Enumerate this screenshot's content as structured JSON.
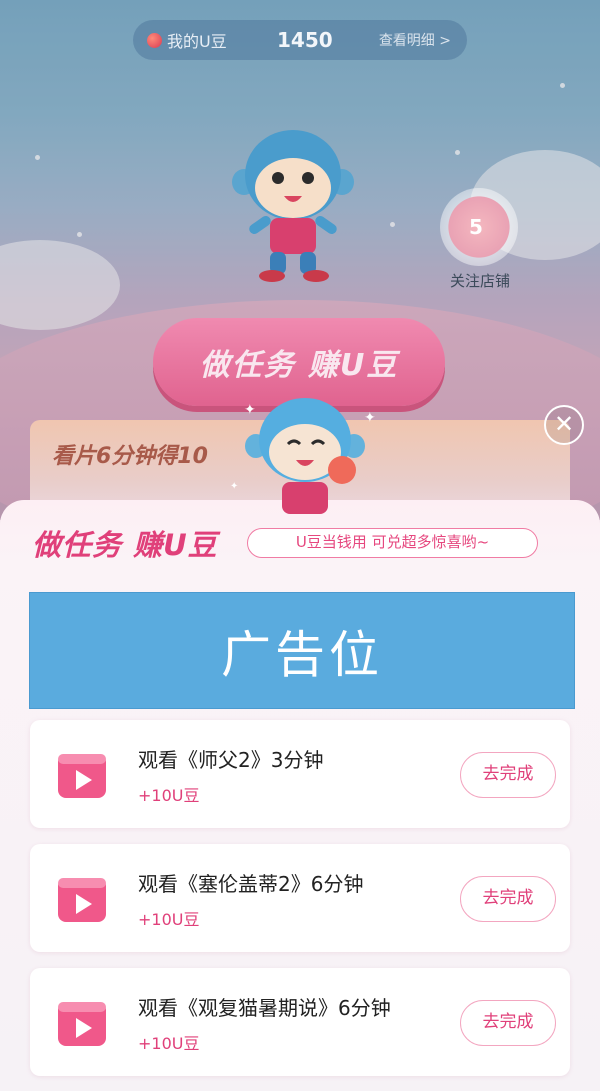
{
  "top_bar": {
    "bean_label": "我的U豆",
    "bean_count": "1450",
    "detail_link": "查看明细 >"
  },
  "follow_shop": {
    "count": "5",
    "label": "关注店铺"
  },
  "background_cta": {
    "label": "做任务 赚U豆"
  },
  "background_strip": {
    "text": "看片6分钟得10"
  },
  "close_icon": "close-icon",
  "sheet": {
    "title": "做任务 赚U豆",
    "subtitle": "U豆当钱用 可兑超多惊喜哟~",
    "ad_label": "广告位",
    "tasks": [
      {
        "title": "观看《师父2》3分钟",
        "reward": "+10U豆",
        "button": "去完成",
        "icon": "play-icon"
      },
      {
        "title": "观看《塞伦盖蒂2》6分钟",
        "reward": "+10U豆",
        "button": "去完成",
        "icon": "play-icon"
      },
      {
        "title": "观看《观复猫暑期说》6分钟",
        "reward": "+10U豆",
        "button": "去完成",
        "icon": "play-icon"
      }
    ]
  },
  "colors": {
    "accent_pink": "#e0407a",
    "ad_blue": "#5aabde"
  }
}
